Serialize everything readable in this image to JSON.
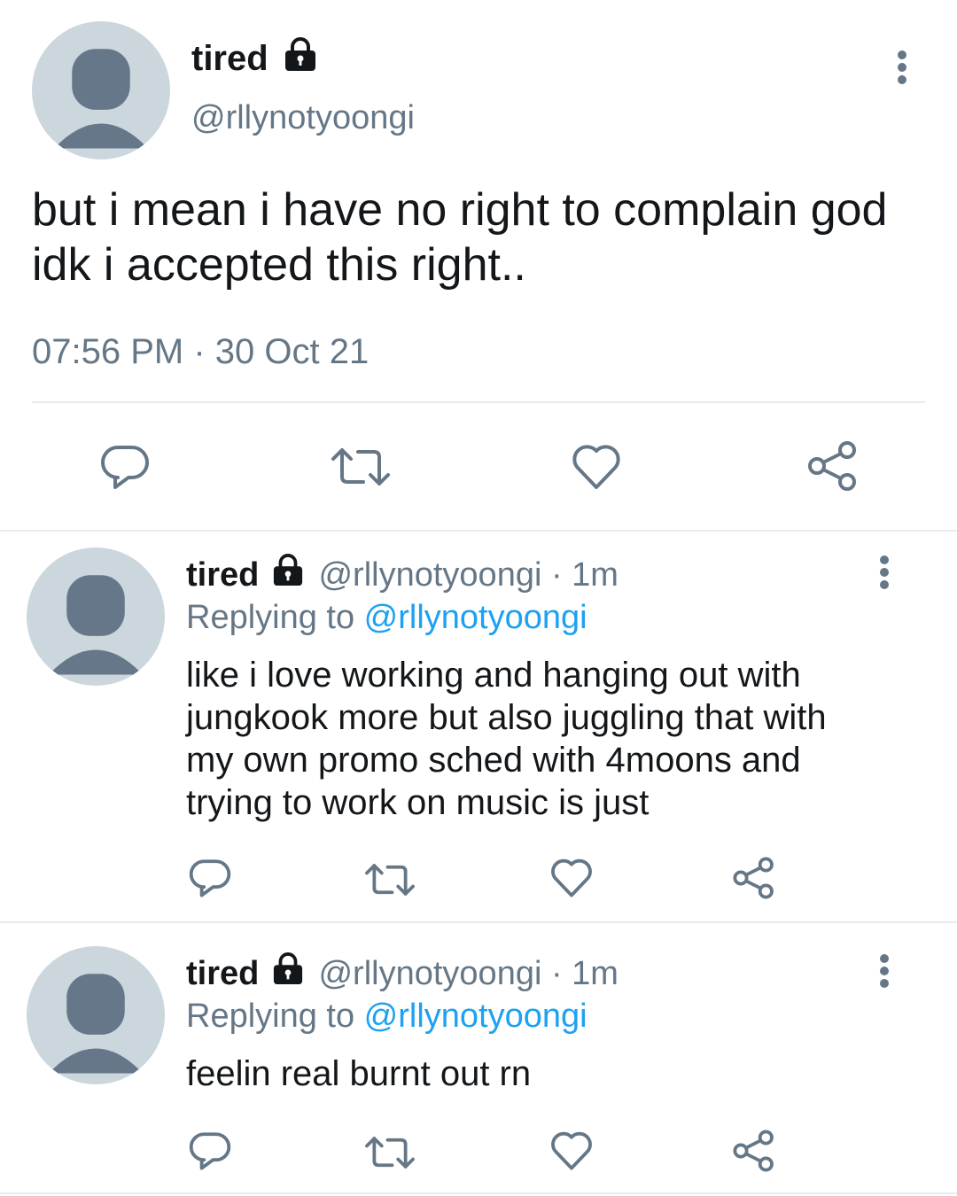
{
  "main_tweet": {
    "display_name": "tired",
    "handle": "@rllynotyoongi",
    "text_line1": "but i mean i have no right to complain god",
    "text_line2": "idk i accepted this right..",
    "timestamp": "07:56 PM · 30 Oct 21"
  },
  "replies": [
    {
      "display_name": "tired",
      "handle_time": "@rllynotyoongi · 1m",
      "replying_prefix": "Replying to ",
      "replying_to": "@rllynotyoongi",
      "lines": [
        "like i love working and hanging out with",
        "jungkook more but also juggling that with",
        "my own promo sched with 4moons and",
        "trying to work on music is just"
      ]
    },
    {
      "display_name": "tired",
      "handle_time": "@rllynotyoongi · 1m",
      "replying_prefix": "Replying to ",
      "replying_to": "@rllynotyoongi",
      "lines": [
        "feelin real burnt out rn"
      ]
    }
  ],
  "colors": {
    "text": "#14171a",
    "secondary": "#657786",
    "link": "#1da1f2",
    "avatar_bg": "#ccd6dd",
    "avatar_fg": "#66778a",
    "divider": "#e6ecf0"
  },
  "icons": [
    "lock-icon",
    "more-options-icon",
    "reply-icon",
    "retweet-icon",
    "like-icon",
    "share-icon",
    "avatar-placeholder"
  ]
}
